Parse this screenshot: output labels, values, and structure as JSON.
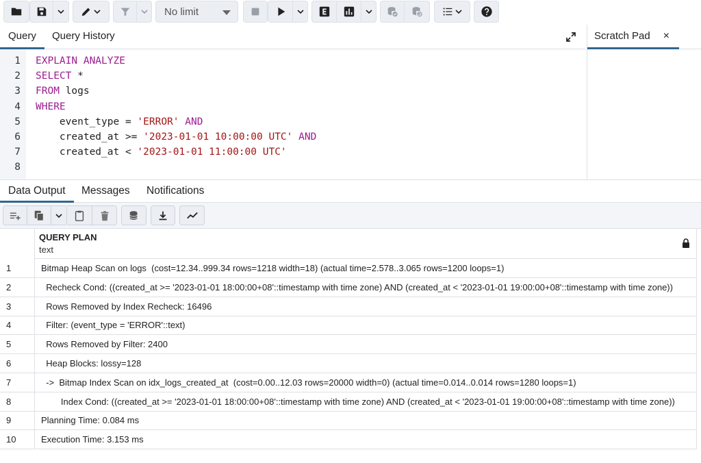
{
  "toolbar": {
    "limit_label": "No limit"
  },
  "query_tabs": {
    "query": "Query",
    "history": "Query History"
  },
  "scratch_pad": {
    "title": "Scratch Pad",
    "close": "×"
  },
  "editor": {
    "lines": [
      {
        "n": "1",
        "tokens": [
          {
            "t": "EXPLAIN ANALYZE",
            "c": "kw"
          }
        ]
      },
      {
        "n": "2",
        "tokens": [
          {
            "t": "SELECT",
            "c": "kw"
          },
          {
            "t": " *",
            "c": "plain"
          }
        ]
      },
      {
        "n": "3",
        "tokens": [
          {
            "t": "FROM",
            "c": "kw"
          },
          {
            "t": " logs",
            "c": "plain"
          }
        ]
      },
      {
        "n": "4",
        "tokens": [
          {
            "t": "WHERE",
            "c": "kw"
          }
        ]
      },
      {
        "n": "5",
        "tokens": [
          {
            "t": "    event_type = ",
            "c": "plain"
          },
          {
            "t": "'ERROR'",
            "c": "str"
          },
          {
            "t": " ",
            "c": "plain"
          },
          {
            "t": "AND",
            "c": "kw"
          }
        ]
      },
      {
        "n": "6",
        "tokens": [
          {
            "t": "    created_at >= ",
            "c": "plain"
          },
          {
            "t": "'2023-01-01 10:00:00 UTC'",
            "c": "str"
          },
          {
            "t": " ",
            "c": "plain"
          },
          {
            "t": "AND",
            "c": "kw"
          }
        ]
      },
      {
        "n": "7",
        "tokens": [
          {
            "t": "    created_at < ",
            "c": "plain"
          },
          {
            "t": "'2023-01-01 11:00:00 UTC'",
            "c": "str"
          }
        ]
      },
      {
        "n": "8",
        "tokens": []
      }
    ]
  },
  "output_tabs": {
    "data_output": "Data Output",
    "messages": "Messages",
    "notifications": "Notifications"
  },
  "grid": {
    "column_name": "QUERY PLAN",
    "column_type": "text",
    "rows": [
      {
        "n": "1",
        "text": "Bitmap Heap Scan on logs  (cost=12.34..999.34 rows=1218 width=18) (actual time=2.578..3.065 rows=1200 loops=1)"
      },
      {
        "n": "2",
        "text": "  Recheck Cond: ((created_at >= '2023-01-01 18:00:00+08'::timestamp with time zone) AND (created_at < '2023-01-01 19:00:00+08'::timestamp with time zone))"
      },
      {
        "n": "3",
        "text": "  Rows Removed by Index Recheck: 16496"
      },
      {
        "n": "4",
        "text": "  Filter: (event_type = 'ERROR'::text)"
      },
      {
        "n": "5",
        "text": "  Rows Removed by Filter: 2400"
      },
      {
        "n": "6",
        "text": "  Heap Blocks: lossy=128"
      },
      {
        "n": "7",
        "text": "  ->  Bitmap Index Scan on idx_logs_created_at  (cost=0.00..12.03 rows=20000 width=0) (actual time=0.014..0.014 rows=1280 loops=1)"
      },
      {
        "n": "8",
        "text": "        Index Cond: ((created_at >= '2023-01-01 18:00:00+08'::timestamp with time zone) AND (created_at < '2023-01-01 19:00:00+08'::timestamp with time zone))"
      },
      {
        "n": "9",
        "text": "Planning Time: 0.084 ms"
      },
      {
        "n": "10",
        "text": "Execution Time: 3.153 ms"
      }
    ]
  }
}
